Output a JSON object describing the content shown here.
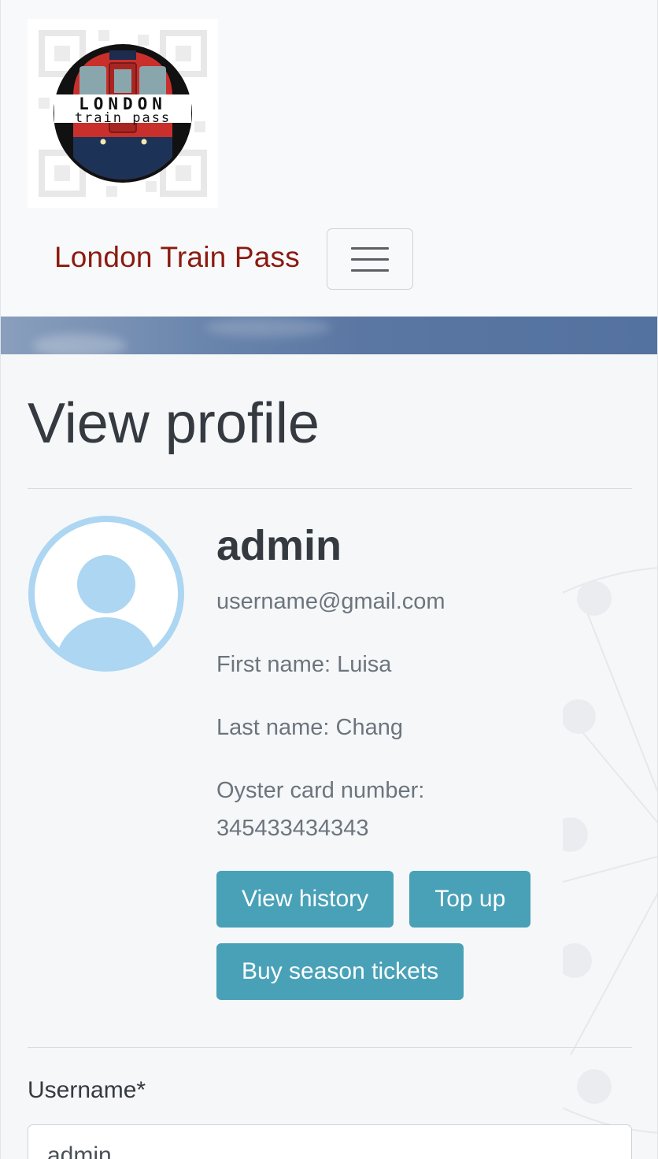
{
  "header": {
    "logo": {
      "line1": "LONDON",
      "line2": "train pass",
      "train_color": "#c9302c",
      "circle_color": "#111111"
    },
    "brand": "London Train Pass",
    "menu_icon": "hamburger-menu-icon"
  },
  "main": {
    "page_title": "View profile",
    "avatar_icon": "user-avatar-icon",
    "avatar_color": "#acd6f2",
    "profile": {
      "name": "admin",
      "email": "username@gmail.com",
      "first_name": "First name: Luisa",
      "last_name": "Last name: Chang",
      "oyster_label": "Oyster card number:",
      "oyster_number": "345433434343"
    },
    "buttons": {
      "view_history": "View history",
      "top_up": "Top up",
      "buy_season": "Buy season tickets"
    },
    "form": {
      "username_label": "Username*",
      "username_value": "admin"
    }
  },
  "colors": {
    "brand": "#8b1a10",
    "button": "#48a1b7",
    "background": "#f6f7f9"
  }
}
